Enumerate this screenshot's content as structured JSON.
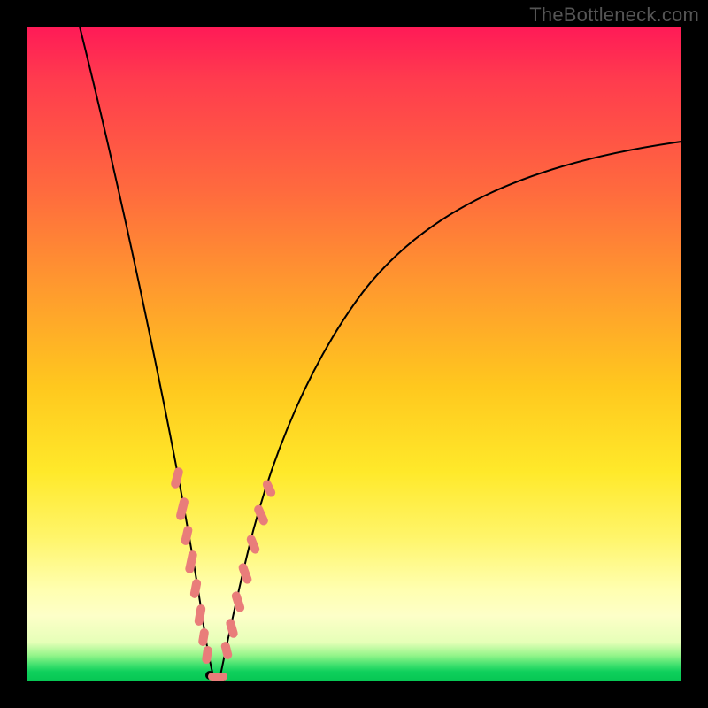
{
  "watermark": "TheBottleneck.com",
  "colors": {
    "gradient_top": "#ff1a57",
    "gradient_mid": "#ffe92a",
    "gradient_bottom": "#06c653",
    "curve": "#000000",
    "markers": "#e97d7a",
    "frame": "#000000"
  },
  "chart_data": {
    "type": "line",
    "title": "",
    "xlabel": "",
    "ylabel": "",
    "xlim": [
      0,
      100
    ],
    "ylim": [
      0,
      100
    ],
    "series": [
      {
        "name": "bottleneck-curve-left",
        "x": [
          8,
          10,
          12,
          14,
          16,
          18,
          20,
          22,
          23,
          24,
          25,
          26,
          27,
          28
        ],
        "y": [
          100,
          88,
          76,
          64,
          52,
          41,
          31,
          21,
          16,
          11,
          7,
          4,
          2,
          0
        ]
      },
      {
        "name": "bottleneck-curve-right",
        "x": [
          28,
          29,
          30,
          31,
          33,
          36,
          40,
          46,
          54,
          64,
          76,
          88,
          100
        ],
        "y": [
          0,
          2,
          5,
          9,
          17,
          27,
          38,
          50,
          60,
          68,
          74,
          79,
          82
        ]
      }
    ],
    "markers": {
      "name": "highlighted-range",
      "color": "#e97d7a",
      "segments_left": [
        [
          21,
          25
        ],
        [
          22,
          19
        ],
        [
          23,
          16
        ],
        [
          24,
          11
        ],
        [
          25,
          8
        ],
        [
          26,
          5
        ]
      ],
      "segments_right": [
        [
          30,
          6
        ],
        [
          31,
          10
        ],
        [
          32,
          14
        ],
        [
          33,
          18
        ],
        [
          34,
          22
        ],
        [
          35,
          25
        ]
      ],
      "floor_dots_x": [
        26,
        27,
        28,
        29,
        30
      ]
    }
  }
}
